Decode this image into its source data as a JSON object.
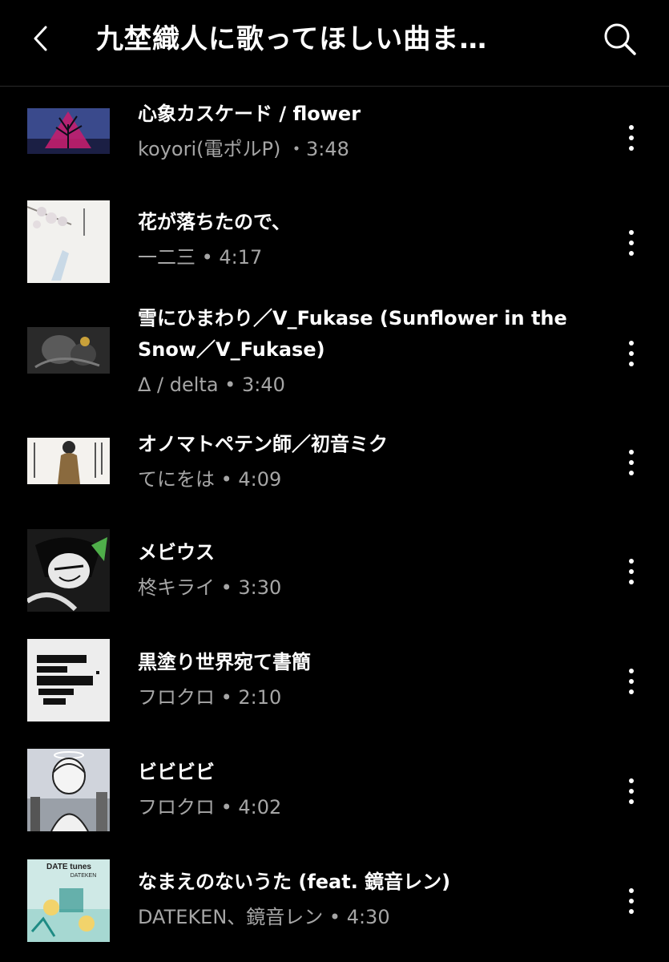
{
  "header": {
    "title": "九埜織人に歌ってほしい曲ま…",
    "back_icon": "chevron-left-icon",
    "search_icon": "search-icon"
  },
  "songs": [
    {
      "title": "心象カスケード / flower",
      "meta": "koyori(電ポルP) ・3:48"
    },
    {
      "title": "花が落ちたので、",
      "meta": "一二三 • 4:17"
    },
    {
      "title": "雪にひまわり／V_Fukase (Sunflower in the Snow／V_Fukase)",
      "meta": "Δ / delta • 3:40"
    },
    {
      "title": "オノマトペテン師／初音ミク",
      "meta": "てにをは • 4:09"
    },
    {
      "title": "メビウス",
      "meta": "柊キライ • 3:30"
    },
    {
      "title": "黒塗り世界宛て書簡",
      "meta": "フロクロ • 2:10"
    },
    {
      "title": "ビビビビ",
      "meta": "フロクロ • 4:02"
    },
    {
      "title": "なまえのないうた (feat. 鏡音レン)",
      "meta": "DATEKEN、鏡音レン • 4:30"
    }
  ],
  "thumbnails": {
    "album_8_text": "DATE tunes",
    "album_8_subtext": "DATEKEN"
  }
}
